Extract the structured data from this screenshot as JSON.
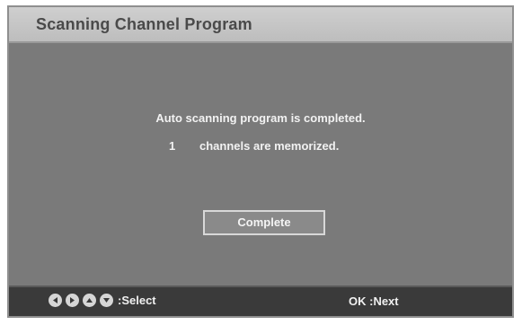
{
  "title": "Scanning Channel Program",
  "message": {
    "line1": "Auto scanning program is completed.",
    "channel_count": "1",
    "line2": "channels are memorized."
  },
  "complete_button": "Complete",
  "footer": {
    "nav_icons": [
      "left-arrow-icon",
      "right-arrow-icon",
      "up-arrow-icon",
      "down-arrow-icon"
    ],
    "select_label": ":Select",
    "ok_label": "OK :Next"
  },
  "colors": {
    "title_bar": "#c7c7c7",
    "content_bg": "#7a7a7a",
    "footer_bg": "#3a3a3a",
    "text": "#f2f2f2"
  }
}
